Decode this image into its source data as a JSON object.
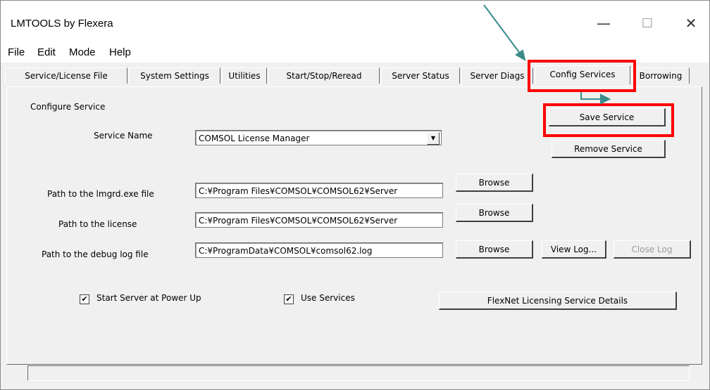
{
  "window": {
    "title": "LMTOOLS by Flexera",
    "minimize_glyph": "—",
    "maximize_glyph": "☐",
    "close_glyph": "✕"
  },
  "menu": [
    "File",
    "Edit",
    "Mode",
    "Help"
  ],
  "tabs": [
    "Service/License File",
    "System Settings",
    "Utilities",
    "Start/Stop/Reread",
    "Server Status",
    "Server Diags",
    "Config Services",
    "Borrowing"
  ],
  "active_tab": "Config Services",
  "config": {
    "section_label": "Configure Service",
    "service_name_label": "Service Name",
    "service_name_value": "COMSOL License Manager",
    "lmgrd_label": "Path to the lmgrd.exe file",
    "lmgrd_value": "C:¥Program Files¥COMSOL¥COMSOL62¥Server",
    "license_label": "Path to the license",
    "license_value": "C:¥Program Files¥COMSOL¥COMSOL62¥Server",
    "debug_label": "Path to the debug log file",
    "debug_value": "C:¥ProgramData¥COMSOL¥comsol62.log",
    "browse_label": "Browse",
    "save_service_label": "Save Service",
    "remove_service_label": "Remove Service",
    "view_log_label": "View Log...",
    "close_log_label": "Close Log",
    "start_at_powerup_label": "Start Server at Power Up",
    "start_at_powerup_checked": true,
    "use_services_label": "Use Services",
    "use_services_checked": true,
    "flexnet_details_label": "FlexNet Licensing Service Details",
    "check_glyph": "✔",
    "dropdown_glyph": "▼"
  },
  "annotation_color": "#ff0000",
  "arrow_color": "#3b8b8b"
}
